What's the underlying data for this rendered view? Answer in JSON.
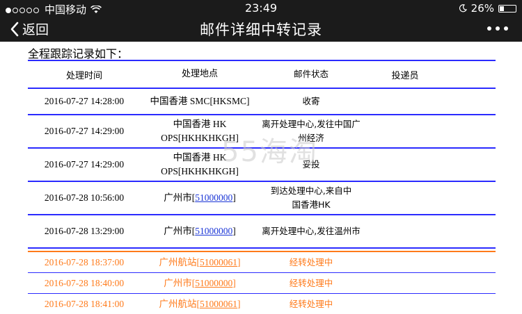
{
  "status_bar": {
    "carrier": "中国移动",
    "time": "23:49",
    "battery": "26%",
    "battery_level": 0.26
  },
  "nav": {
    "back_label": "返回",
    "title": "邮件详细中转记录"
  },
  "heading": "全程跟踪记录如下：",
  "table": {
    "headers": [
      "处理时间",
      "处理地点",
      "邮件状态",
      "投递员"
    ],
    "rows": [
      {
        "time": "2016-07-27 14:28:00",
        "place": "中国香港 SMC[HKSMC]",
        "code": "",
        "place_suffix": "",
        "status": "收寄"
      },
      {
        "time": "2016-07-27 14:29:00",
        "place": "中国香港 HK OPS[HKHKHKGH]",
        "code": "",
        "place_suffix": "",
        "status": "离开处理中心,发往中国广州经济"
      },
      {
        "time": "2016-07-27 14:29:00",
        "place": "中国香港 HK OPS[HKHKHKGH]",
        "code": "",
        "place_suffix": "",
        "status": "妥投"
      },
      {
        "time": "2016-07-28 10:56:00",
        "place": "广州市[",
        "code": "51000000",
        "place_suffix": "]",
        "status": "到达处理中心,来自中国香港HK"
      },
      {
        "time": "2016-07-28 13:29:00",
        "place": "广州市[",
        "code": "51000000",
        "place_suffix": "]",
        "status": "离开处理中心,发往温州市"
      },
      {
        "time": "2016-07-28 18:37:00",
        "place": "广州航站[",
        "code": "51000061",
        "place_suffix": "]",
        "status": "经转处理中"
      },
      {
        "time": "2016-07-28 18:40:00",
        "place": "广州市[",
        "code": "51000000",
        "place_suffix": "]",
        "status": "经转处理中"
      },
      {
        "time": "2016-07-28 18:41:00",
        "place": "广州航站[",
        "code": "51000061",
        "place_suffix": "]",
        "status": "经转处理中"
      }
    ]
  },
  "watermark": "55海淘",
  "colors": {
    "bar": "#1b1b1b",
    "rule": "#2a2aff",
    "highlight": "#ff7a1a",
    "link": "#1a35d6"
  }
}
